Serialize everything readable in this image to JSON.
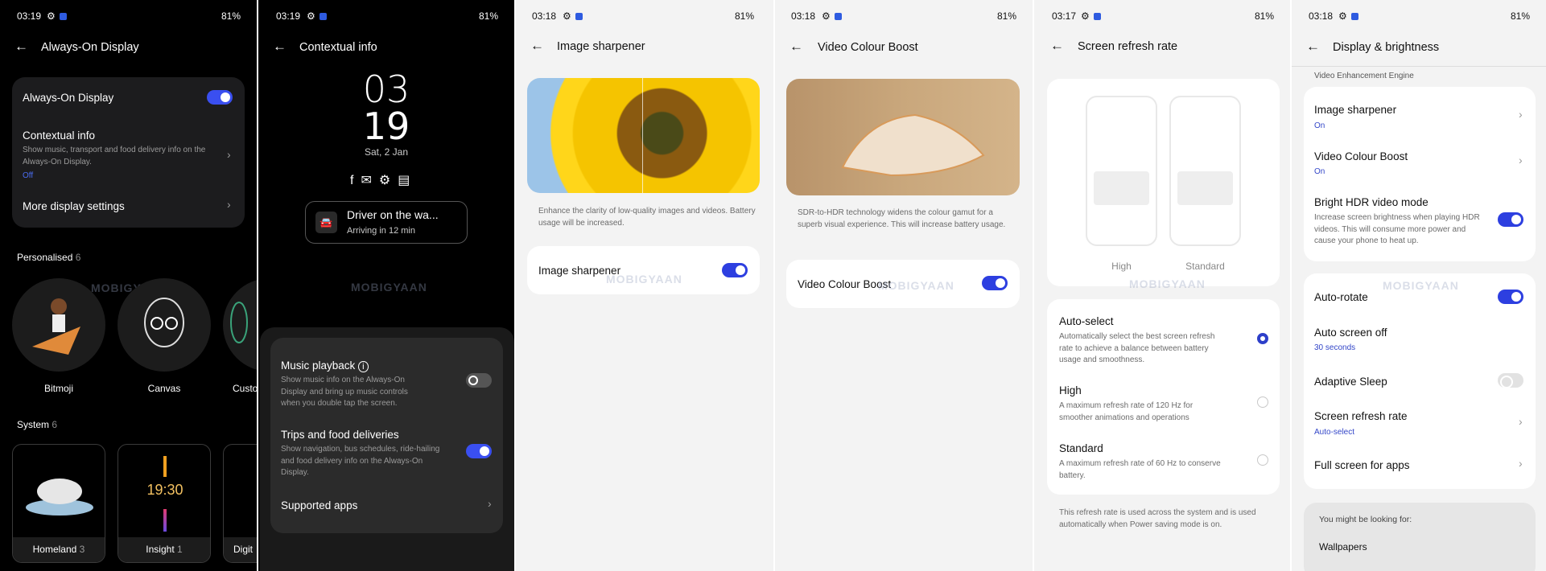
{
  "status": {
    "battery": "81%"
  },
  "watermark": "MOBIGYAAN",
  "colors": {
    "accent": "#3a4ff0",
    "link": "#3346c8"
  },
  "p1": {
    "time": "03:19",
    "title": "Always-On Display",
    "aod": "Always-On Display",
    "aod_on": true,
    "ctx_title": "Contextual info",
    "ctx_desc": "Show music, transport and food delivery info on the Always-On Display.",
    "ctx_value": "Off",
    "more": "More display settings",
    "personalised": "Personalised",
    "personalised_count": "6",
    "circles": [
      "Bitmoji",
      "Canvas",
      "Custo"
    ],
    "system": "System",
    "system_count": "6",
    "tiles": [
      {
        "name": "Homeland",
        "count": "3"
      },
      {
        "name": "Insight",
        "count": "1",
        "clock": "19:30"
      },
      {
        "name": "Digit",
        "count": ""
      }
    ]
  },
  "p2": {
    "time": "03:19",
    "title": "Contextual info",
    "hour": "03",
    "minute": "19",
    "date": "Sat, 2 Jan",
    "notif_title": "Driver on the wa...",
    "notif_sub": "Arriving in 12 min",
    "music": "Music playback",
    "music_desc": "Show music info on the Always-On Display and bring up music controls when you double tap the screen.",
    "music_on": false,
    "trips": "Trips and food deliveries",
    "trips_desc": "Show navigation, bus schedules, ride-hailing and food delivery info on the Always-On Display.",
    "trips_on": true,
    "apps": "Supported apps"
  },
  "p3": {
    "time": "03:18",
    "title": "Image sharpener",
    "desc": "Enhance the clarity of low-quality images and videos. Battery usage will be increased.",
    "item": "Image sharpener",
    "on": true
  },
  "p4": {
    "time": "03:18",
    "title": "Video Colour Boost",
    "desc": "SDR-to-HDR technology widens the colour gamut for a superb visual experience. This will increase battery usage.",
    "item": "Video Colour Boost",
    "on": true
  },
  "p5": {
    "time": "03:17",
    "title": "Screen refresh rate",
    "preview_high": "High",
    "preview_standard": "Standard",
    "options": [
      {
        "title": "Auto-select",
        "desc": "Automatically select the best screen refresh rate to achieve a balance between battery usage and smoothness.",
        "selected": true
      },
      {
        "title": "High",
        "desc": "A maximum refresh rate of 120 Hz for smoother animations and operations",
        "selected": false
      },
      {
        "title": "Standard",
        "desc": "A maximum refresh rate of 60 Hz to conserve battery.",
        "selected": false
      }
    ],
    "footer": "This refresh rate is used across the system and is used automatically when Power saving mode is on."
  },
  "p6": {
    "time": "03:18",
    "title": "Display & brightness",
    "section": "Video Enhancement Engine",
    "sharpener": "Image sharpener",
    "sharpener_val": "On",
    "vcb": "Video Colour Boost",
    "vcb_val": "On",
    "hdr": "Bright HDR video mode",
    "hdr_desc": "Increase screen brightness when playing HDR videos. This will consume more power and cause your phone to heat up.",
    "autorotate": "Auto-rotate",
    "screenoff": "Auto screen off",
    "screenoff_val": "30 seconds",
    "sleep": "Adaptive Sleep",
    "refresh": "Screen refresh rate",
    "refresh_val": "Auto-select",
    "fullscreen": "Full screen for apps",
    "looking": "You might be looking for:",
    "wallpapers": "Wallpapers"
  }
}
